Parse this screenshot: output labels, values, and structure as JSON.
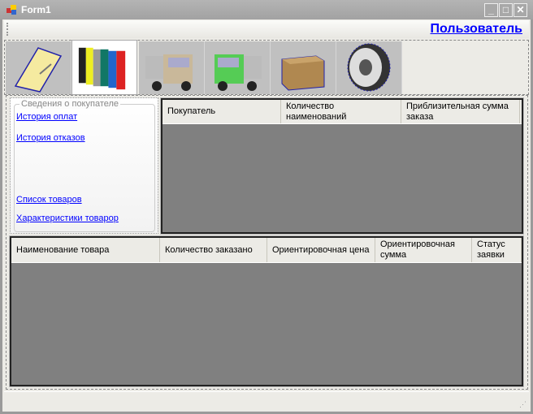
{
  "window": {
    "title": "Form1"
  },
  "menu": {
    "user_link": "Пользователь"
  },
  "toolbar": {
    "items": [
      {
        "icon": "notepad-icon"
      },
      {
        "icon": "binders-icon",
        "selected": true
      },
      {
        "icon": "truck-beige-icon"
      },
      {
        "icon": "truck-green-icon"
      },
      {
        "icon": "box-icon"
      },
      {
        "icon": "gear-icon"
      }
    ]
  },
  "left_panel": {
    "group_title": "Сведения о покупателе",
    "links": [
      "История оплат",
      "История отказов",
      "Список товаров",
      "Характеристики товарор"
    ]
  },
  "customers_grid": {
    "columns": [
      "Покупатель",
      "Количество наименований",
      "Приблизительная сумма заказа"
    ]
  },
  "orders_grid": {
    "columns": [
      "Наименование товара",
      "Количество заказано",
      "Ориентировочная цена",
      "Ориентировочная сумма",
      "Статус заявки"
    ]
  }
}
